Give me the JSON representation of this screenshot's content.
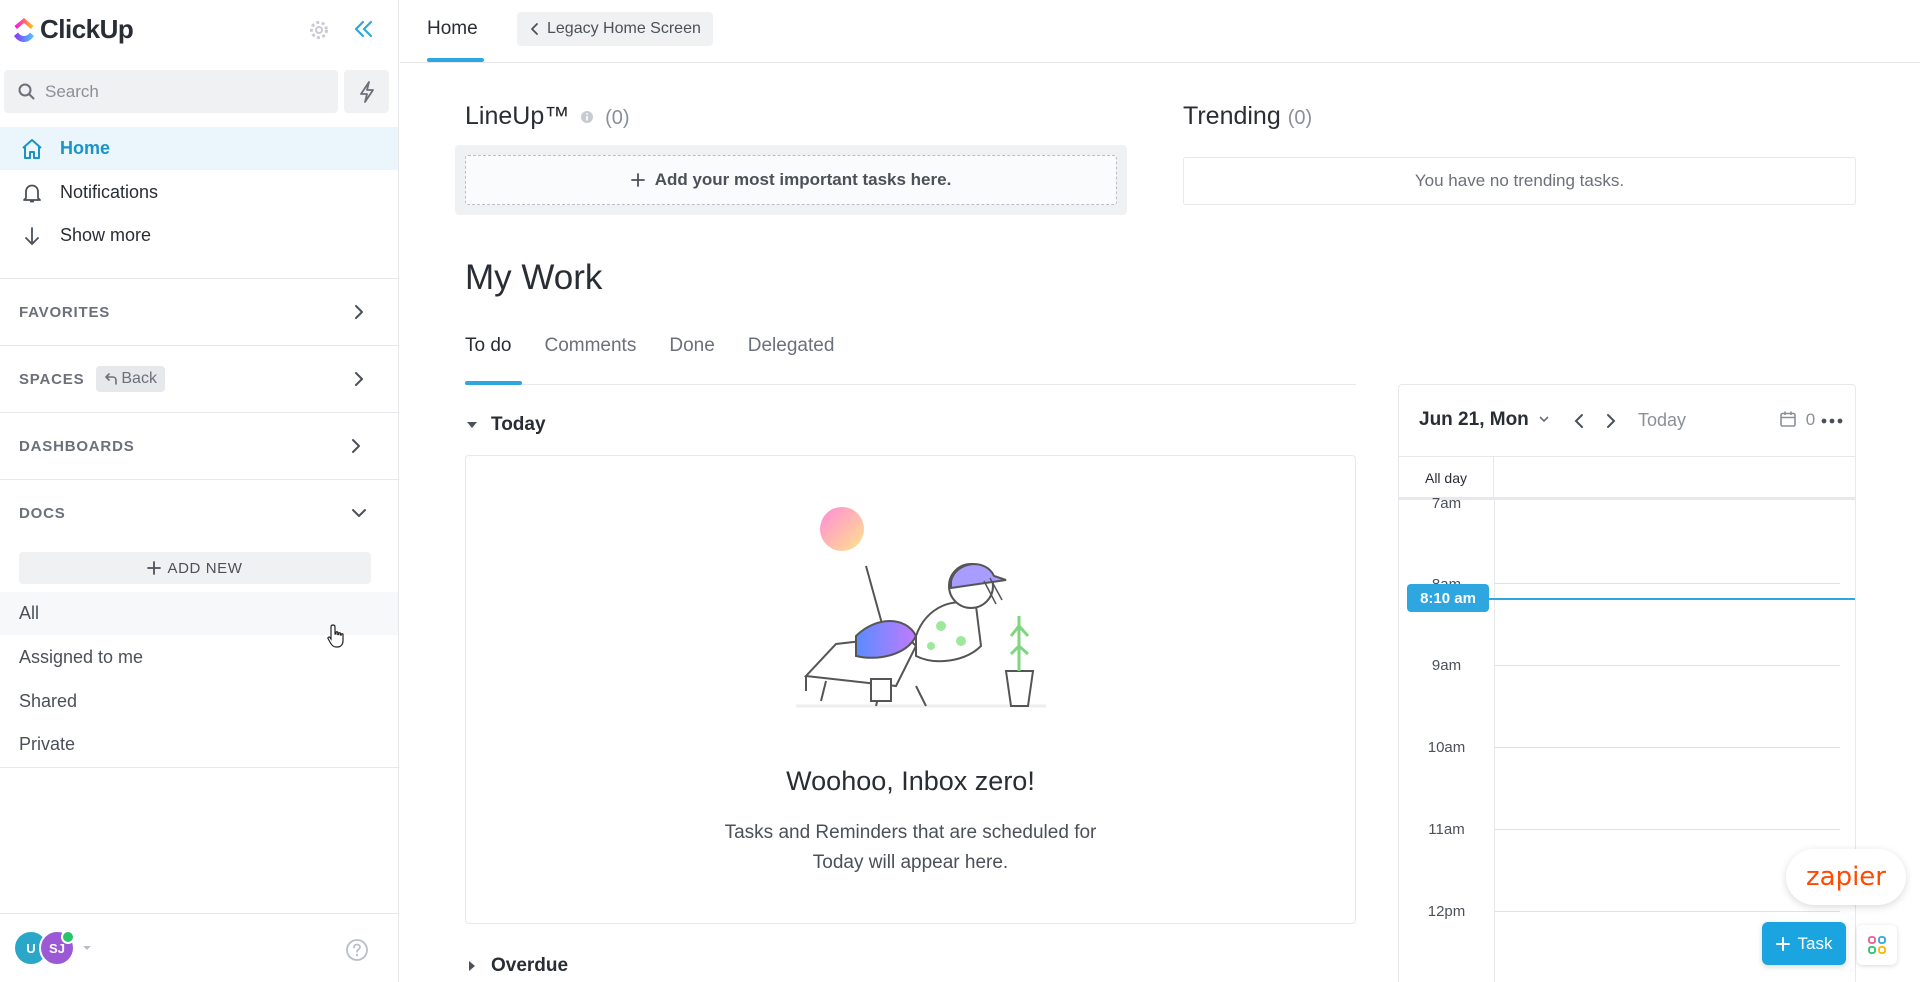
{
  "app": {
    "logo_text": "ClickUp"
  },
  "sidebar": {
    "search_placeholder": "Search",
    "nav": [
      {
        "label": "Home"
      },
      {
        "label": "Notifications"
      },
      {
        "label": "Show more"
      }
    ],
    "sections": {
      "favorites": "FAVORITES",
      "spaces": "SPACES",
      "spaces_back": "Back",
      "dashboards": "DASHBOARDS",
      "docs": "DOCS"
    },
    "add_new": "ADD NEW",
    "docs_items": [
      {
        "label": "All"
      },
      {
        "label": "Assigned to me"
      },
      {
        "label": "Shared"
      },
      {
        "label": "Private"
      }
    ],
    "avatars": {
      "u": "U",
      "sj": "SJ"
    }
  },
  "topbar": {
    "tab_home": "Home",
    "legacy": "Legacy Home Screen"
  },
  "lineup": {
    "title": "LineUp™",
    "count": "(0)",
    "add_label": "Add your most important tasks here."
  },
  "trending": {
    "title": "Trending",
    "count": "(0)",
    "empty": "You have no trending tasks."
  },
  "mywork": {
    "title": "My Work",
    "tabs": [
      {
        "label": "To do"
      },
      {
        "label": "Comments"
      },
      {
        "label": "Done"
      },
      {
        "label": "Delegated"
      }
    ],
    "today_label": "Today",
    "overdue_label": "Overdue",
    "empty_title": "Woohoo, Inbox zero!",
    "empty_line1": "Tasks and Reminders that are scheduled for",
    "empty_line2": "Today will appear here."
  },
  "calendar": {
    "date": "Jun 21, Mon",
    "today": "Today",
    "count": "0",
    "allday": "All day",
    "now": "8:10 am",
    "hours": [
      "7am",
      "8am",
      "9am",
      "10am",
      "11am",
      "12pm"
    ]
  },
  "floating": {
    "zapier": "zapier",
    "task": "Task"
  },
  "colors": {
    "accent": "#2ea6e0",
    "brand_orange": "#ff4a00"
  }
}
